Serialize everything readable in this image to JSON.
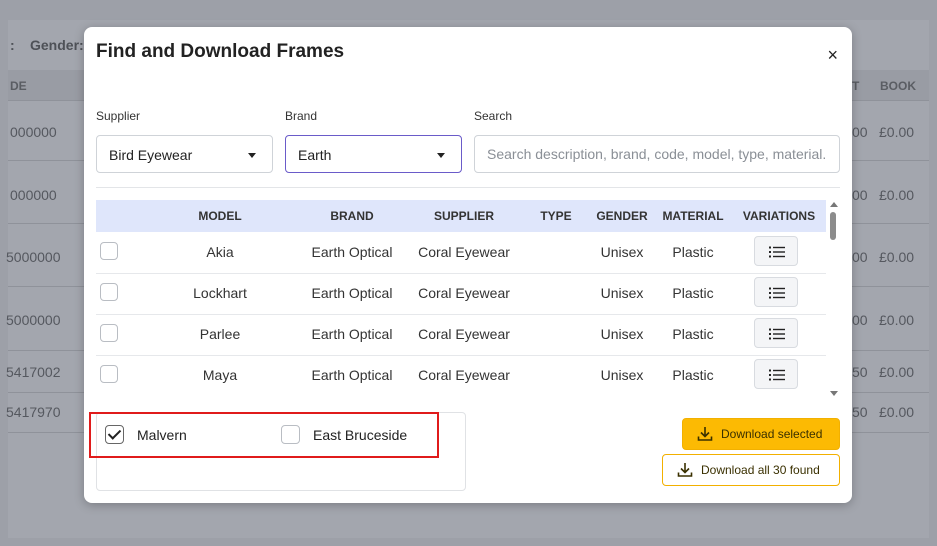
{
  "background": {
    "filter_label": "Gender:",
    "col_left_header": "DE",
    "col_t_header": "T",
    "col_book_header": "BOOK",
    "left_values": [
      "000000",
      "000000",
      "5000000",
      "5000000",
      "5417002",
      "5417970"
    ],
    "right_price_prefix": [
      "00",
      "00",
      "00",
      "00",
      "50",
      "50"
    ],
    "right_prices": [
      "£0.00",
      "£0.00",
      "£0.00",
      "£0.00",
      "£0.00",
      "£0.00"
    ]
  },
  "modal": {
    "title": "Find and Download Frames",
    "close_symbol": "×"
  },
  "filters": {
    "supplier_label": "Supplier",
    "supplier_value": "Bird Eyewear",
    "brand_label": "Brand",
    "brand_value": "Earth",
    "search_label": "Search",
    "search_placeholder": "Search description, brand, code, model, type, material.."
  },
  "table": {
    "columns": [
      "MODEL",
      "BRAND",
      "SUPPLIER",
      "TYPE",
      "GENDER",
      "MATERIAL",
      "VARIATIONS"
    ],
    "rows": [
      {
        "model": "Akia",
        "brand": "Earth Optical",
        "supplier": "Coral Eyewear",
        "type": "",
        "gender": "Unisex",
        "material": "Plastic"
      },
      {
        "model": "Lockhart",
        "brand": "Earth Optical",
        "supplier": "Coral Eyewear",
        "type": "",
        "gender": "Unisex",
        "material": "Plastic"
      },
      {
        "model": "Parlee",
        "brand": "Earth Optical",
        "supplier": "Coral Eyewear",
        "type": "",
        "gender": "Unisex",
        "material": "Plastic"
      },
      {
        "model": "Maya",
        "brand": "Earth Optical",
        "supplier": "Coral Eyewear",
        "type": "",
        "gender": "Unisex",
        "material": "Plastic"
      }
    ]
  },
  "locations": [
    {
      "label": "Malvern",
      "checked": true
    },
    {
      "label": "East Bruceside",
      "checked": false
    }
  ],
  "actions": {
    "download_selected": "Download selected",
    "download_all": "Download all 30 found"
  },
  "colors": {
    "accent_yellow": "#fcba03",
    "highlight_red": "#e01b1b",
    "table_header": "#dfe6fb",
    "brand_border": "#6a5bc9"
  }
}
